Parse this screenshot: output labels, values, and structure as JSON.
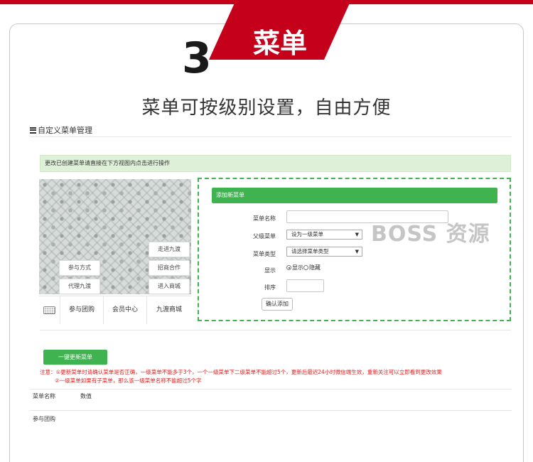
{
  "banner": {
    "title": "菜单",
    "step_number": "3"
  },
  "headline": "菜单可按级别设置，自由方便",
  "section_title": "自定义菜单管理",
  "notice": "更改已创建菜单请直接在下方视图内点击进行操作",
  "phone_preview": {
    "submenu_right": [
      "走进九渡",
      "招商合作",
      "进入商城"
    ],
    "submenu_left": [
      "参与方式",
      "代理九渡"
    ],
    "main_menus": [
      "参与团购",
      "会员中心",
      "九渡商城"
    ]
  },
  "form": {
    "header": "添加新菜单",
    "name_label": "菜单名称",
    "name_value": "",
    "parent_label": "父级菜单",
    "parent_value": "设为一级菜单",
    "type_label": "菜单类型",
    "type_value": "请选择菜单类型",
    "display_label": "显示",
    "display_show": "显示",
    "display_hide": "隐藏",
    "order_label": "排序",
    "order_value": "",
    "confirm_label": "确认添加"
  },
  "watermark": "BOSS 资源",
  "update_button": "一键更新菜单",
  "notes": [
    "注意：①更新菜单时请确认菜单是否正确，一级菜单不能多于3个，一个一级菜单下二级菜单不能超过5个，更新后最迟24小时微信端生效，重新关注可以立即看到更改效果",
    "②一级菜单如果有子菜单，那么该一级菜单名称不能超过5个字"
  ],
  "table": {
    "headers": [
      "菜单名称",
      "数值"
    ],
    "rows": [
      [
        "参与团购",
        ""
      ]
    ]
  },
  "colors": {
    "brand_red": "#c4001a",
    "accent_green": "#3fb34f",
    "note_red": "#e02020"
  }
}
